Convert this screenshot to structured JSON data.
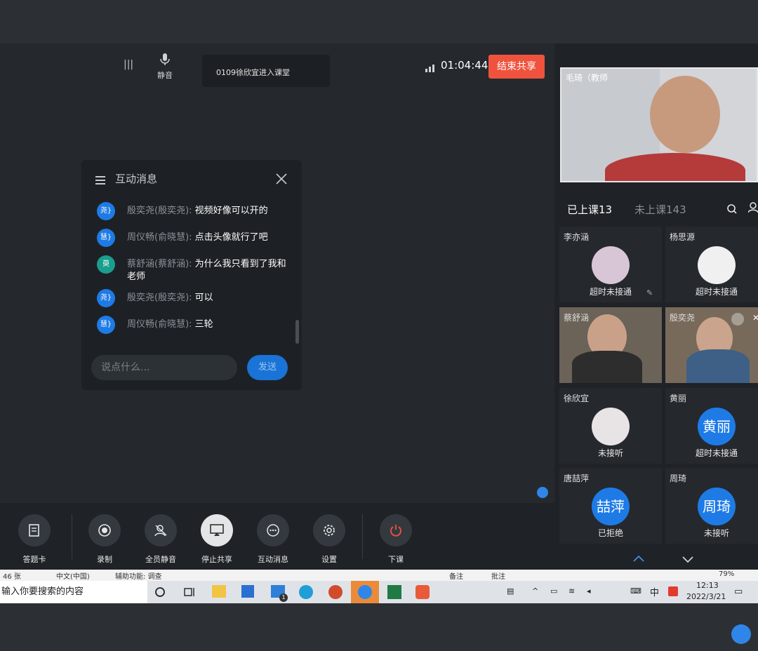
{
  "sharebar": {
    "mute_label": "静音",
    "notification": "0109徐欣宜进入课堂",
    "timer": "01:04:44",
    "end_share_label": "结束共享"
  },
  "chat": {
    "title": "互动消息",
    "messages": [
      {
        "avatar": "尧}",
        "sender": "殷奕尧(殷奕尧):",
        "text": "视频好像可以开的"
      },
      {
        "avatar": "慧}",
        "sender": "周仪畅(俞晓慧):",
        "text": "点击头像就行了吧"
      },
      {
        "avatar": "萸",
        "sender": "蔡舒涵(蔡舒涵):",
        "text": "为什么我只看到了我和老师"
      },
      {
        "avatar": "尧}",
        "sender": "殷奕尧(殷奕尧):",
        "text": "可以"
      },
      {
        "avatar": "慧}",
        "sender": "周仪畅(俞晓慧):",
        "text": "三轮"
      }
    ],
    "input_placeholder": "说点什么...",
    "send_label": "发送"
  },
  "toolbar": [
    {
      "label": "答题卡",
      "icon": "answer-card-icon"
    },
    {
      "label": "录制",
      "icon": "record-icon"
    },
    {
      "label": "全员静音",
      "icon": "mute-all-icon"
    },
    {
      "label": "停止共享",
      "icon": "stop-share-icon"
    },
    {
      "label": "互动消息",
      "icon": "chat-icon"
    },
    {
      "label": "设置",
      "icon": "settings-icon"
    },
    {
      "label": "下课",
      "icon": "power-icon"
    }
  ],
  "teacher": {
    "label": "毛琦（教师"
  },
  "tabs": {
    "joined": "已上课13",
    "not_joined": "未上课143"
  },
  "students": [
    {
      "name": "李亦涵",
      "status": "超时未接通"
    },
    {
      "name": "杨思源",
      "status": "超时未接通"
    },
    {
      "name": "蔡舒涵",
      "status": ""
    },
    {
      "name": "殷奕尧",
      "status": ""
    },
    {
      "name": "徐欣宜",
      "status": "未接听"
    },
    {
      "name": "黄丽",
      "status": "超时未接通",
      "avatar": "黄丽"
    },
    {
      "name": "唐喆萍",
      "status": "已拒绝",
      "avatar": "喆萍"
    },
    {
      "name": "周琦",
      "status": "未接听",
      "avatar": "周琦"
    }
  ],
  "taskbar": {
    "status_left": "46 张",
    "status_lang": "中文(中国)",
    "status_access": "辅助功能: 调查",
    "status_notes": "备注",
    "status_comments": "批注",
    "zoom": "79%",
    "search_placeholder": "输入你要搜索的内容",
    "time": "12:13",
    "date": "2022/3/21",
    "ime": "中",
    "mail_badge": "1"
  },
  "colors": {
    "accent": "#1e7be6",
    "danger": "#f0533d",
    "panel": "#1f2226"
  }
}
